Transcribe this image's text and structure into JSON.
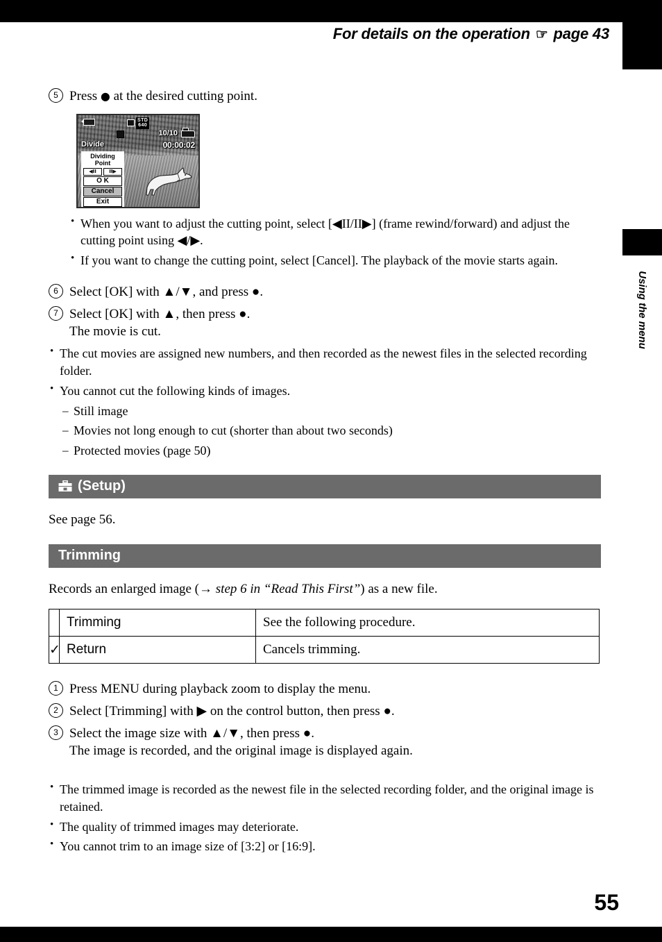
{
  "header": {
    "running_title_prefix": "For details on the operation",
    "hand_icon": "pointing-hand-icon",
    "running_title_suffix": "page 43"
  },
  "side_tab": {
    "label": "Using the menu"
  },
  "footer": {
    "page_number": "55"
  },
  "colors": {
    "section_bar": "#6b6b6b",
    "text": "#000000",
    "bar_black": "#000000"
  },
  "steps_divide": [
    {
      "num": "5",
      "text_before": "Press",
      "glyph": "●",
      "text_after": "at the desired cutting point."
    },
    {
      "num": "6",
      "line": "Select [OK] with ▲/▼, and press ●."
    },
    {
      "num": "7",
      "line": "Select [OK] with ▲, then press ●.",
      "sub": "The movie is cut."
    }
  ],
  "lcd": {
    "caption_divide": "Divide",
    "std_line1": "STD",
    "std_line2": "640",
    "counter": "10/10",
    "timecode": "00:00:02",
    "menu": {
      "title_line1": "Dividing",
      "title_line2": "Point",
      "frame_rewind": "◀II",
      "frame_forward": "II▶",
      "items": [
        {
          "label": "O K",
          "selected": false
        },
        {
          "label": "Cancel",
          "selected": true
        },
        {
          "label": "Exit",
          "selected": false
        }
      ]
    },
    "icons": {
      "battery": "battery-icon",
      "folder": "folder-icon",
      "rec": "record-square-icon"
    }
  },
  "notes_after_step5": [
    "When you want to adjust the cutting point, select [◀II/II▶] (frame rewind/forward) and adjust the cutting point using ◀/▶.",
    "If you want to change the cutting point, select [Cancel]. The playback of the movie starts again."
  ],
  "notes_divide": [
    "The cut movies are assigned new numbers, and then recorded as the newest files in the selected recording folder.",
    "You cannot cut the following kinds of images."
  ],
  "notes_divide_sub": [
    "Still image",
    "Movies not long enough to cut (shorter than about two seconds)",
    "Protected movies (page 50)"
  ],
  "setup_section": {
    "icon": "toolbox-icon",
    "title": "(Setup)",
    "body": "See page 56."
  },
  "trimming_section": {
    "title": "Trimming",
    "intro_part1": "Records an enlarged image (→ ",
    "intro_italic": "step 6 in “Read This First”",
    "intro_part2": ") as a new file.",
    "table": {
      "rows": [
        {
          "check": "",
          "label": "Trimming",
          "desc": "See the following procedure."
        },
        {
          "check": "✓",
          "label": "Return",
          "desc": "Cancels trimming."
        }
      ]
    },
    "steps": [
      {
        "num": "1",
        "line": "Press MENU during playback zoom to display the menu."
      },
      {
        "num": "2",
        "line": "Select [Trimming] with ▶ on the control button, then press ●."
      },
      {
        "num": "3",
        "line": "Select the image size with ▲/▼, then press ●.",
        "sub": "The image is recorded, and the original image is displayed again."
      }
    ],
    "notes": [
      "The trimmed image is recorded as the newest file in the selected recording folder, and the original image is retained.",
      "The quality of trimmed images may deteriorate.",
      "You cannot trim to an image size of [3:2] or [16:9]."
    ]
  }
}
